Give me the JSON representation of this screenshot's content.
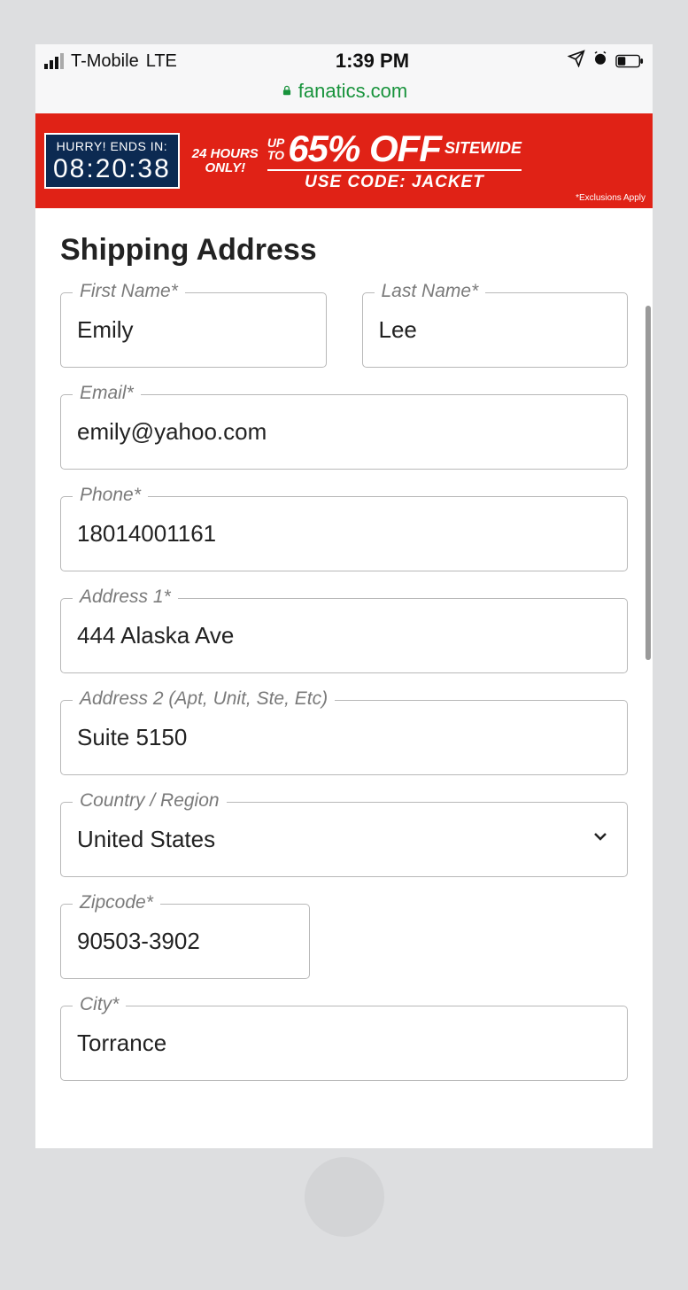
{
  "statusbar": {
    "carrier": "T-Mobile",
    "network": "LTE",
    "time": "1:39 PM"
  },
  "browser": {
    "domain": "fanatics.com"
  },
  "promo": {
    "hurry": "HURRY! ENDS IN:",
    "countdown": "08:20:38",
    "line_24hours": "24 HOURS",
    "line_only": "ONLY!",
    "up_to": "UP TO",
    "percent": "65% OFF",
    "sitewide": "SITEWIDE",
    "use_code": "USE CODE: JACKET",
    "exclusions": "*Exclusions Apply"
  },
  "form": {
    "title": "Shipping Address",
    "first_name": {
      "label": "First Name*",
      "value": "Emily"
    },
    "last_name": {
      "label": "Last Name*",
      "value": "Lee"
    },
    "email": {
      "label": "Email*",
      "value": "emily@yahoo.com"
    },
    "phone": {
      "label": "Phone*",
      "value": "18014001161"
    },
    "address1": {
      "label": "Address 1*",
      "value": "444 Alaska Ave"
    },
    "address2": {
      "label": "Address 2 (Apt, Unit, Ste, Etc)",
      "value": "Suite 5150"
    },
    "country": {
      "label": "Country / Region",
      "value": "United States"
    },
    "zipcode": {
      "label": "Zipcode*",
      "value": "90503-3902"
    },
    "city": {
      "label": "City*",
      "value": "Torrance"
    }
  }
}
